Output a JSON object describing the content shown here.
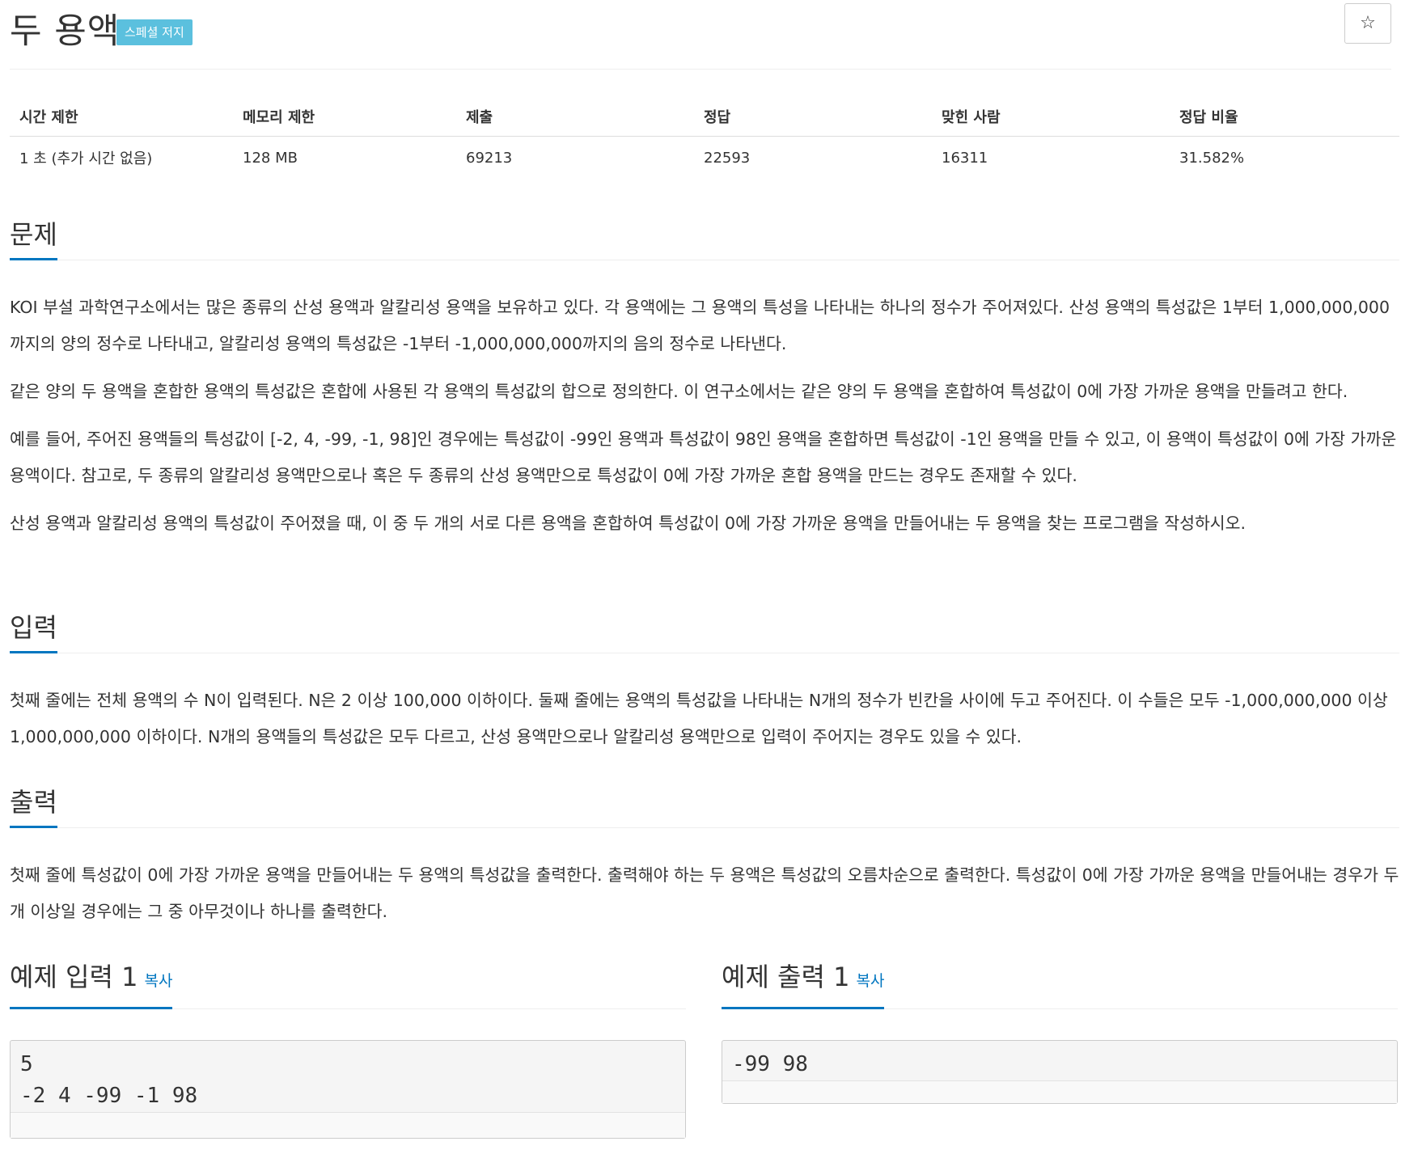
{
  "header": {
    "title": "두 용액",
    "badge": "스페셜 저지",
    "star_glyph": "☆"
  },
  "info": {
    "headers": [
      "시간 제한",
      "메모리 제한",
      "제출",
      "정답",
      "맞힌 사람",
      "정답 비율"
    ],
    "values": [
      "1 초 (추가 시간 없음)",
      "128 MB",
      "69213",
      "22593",
      "16311",
      "31.582%"
    ]
  },
  "problem": {
    "title": "문제",
    "paragraphs": [
      "KOI 부설 과학연구소에서는 많은 종류의 산성 용액과 알칼리성 용액을 보유하고 있다. 각 용액에는 그 용액의 특성을 나타내는 하나의 정수가 주어져있다. 산성 용액의 특성값은 1부터 1,000,000,000까지의 양의 정수로 나타내고, 알칼리성 용액의 특성값은 -1부터 -1,000,000,000까지의 음의 정수로 나타낸다.",
      "같은 양의 두 용액을 혼합한 용액의 특성값은 혼합에 사용된 각 용액의 특성값의 합으로 정의한다. 이 연구소에서는 같은 양의 두 용액을 혼합하여 특성값이 0에 가장 가까운 용액을 만들려고 한다.",
      "예를 들어, 주어진 용액들의 특성값이 [-2, 4, -99, -1, 98]인 경우에는 특성값이 -99인 용액과 특성값이 98인 용액을 혼합하면 특성값이 -1인 용액을 만들 수 있고, 이 용액이 특성값이 0에 가장 가까운 용액이다. 참고로, 두 종류의 알칼리성 용액만으로나 혹은 두 종류의 산성 용액만으로 특성값이 0에 가장 가까운 혼합 용액을 만드는 경우도 존재할 수 있다.",
      "산성 용액과 알칼리성 용액의 특성값이 주어졌을 때, 이 중 두 개의 서로 다른 용액을 혼합하여 특성값이 0에 가장 가까운 용액을 만들어내는 두 용액을 찾는 프로그램을 작성하시오."
    ]
  },
  "input": {
    "title": "입력",
    "paragraphs": [
      "첫째 줄에는 전체 용액의 수 N이 입력된다. N은 2 이상 100,000 이하이다. 둘째 줄에는 용액의 특성값을 나타내는 N개의 정수가 빈칸을 사이에 두고 주어진다. 이 수들은 모두 -1,000,000,000 이상 1,000,000,000 이하이다. N개의 용액들의 특성값은 모두 다르고, 산성 용액만으로나 알칼리성 용액만으로 입력이 주어지는 경우도 있을 수 있다."
    ]
  },
  "output": {
    "title": "출력",
    "paragraphs": [
      "첫째 줄에 특성값이 0에 가장 가까운 용액을 만들어내는 두 용액의 특성값을 출력한다. 출력해야 하는 두 용액은 특성값의 오름차순으로 출력한다. 특성값이 0에 가장 가까운 용액을 만들어내는 경우가 두 개 이상일 경우에는 그 중 아무것이나 하나를 출력한다."
    ]
  },
  "sample_input": {
    "title": "예제 입력 1",
    "copy_label": "복사",
    "content": "5\n-2 4 -99 -1 98"
  },
  "sample_output": {
    "title": "예제 출력 1",
    "copy_label": "복사",
    "content": "-99 98"
  }
}
